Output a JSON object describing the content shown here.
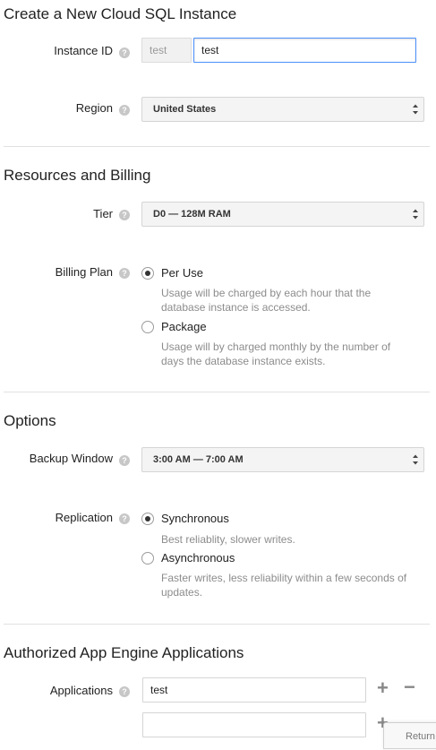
{
  "instance": {
    "title": "Create a New Cloud SQL Instance",
    "id_label": "Instance ID",
    "id_prefix": "test",
    "id_value": "test",
    "region_label": "Region",
    "region_value": "United States"
  },
  "resources": {
    "title": "Resources and Billing",
    "tier_label": "Tier",
    "tier_value": "D0 — 128M RAM",
    "billing_label": "Billing Plan",
    "plans": [
      {
        "label": "Per Use",
        "desc": "Usage will be charged by each hour that the database instance is accessed.",
        "checked": true
      },
      {
        "label": "Package",
        "desc": "Usage will by charged monthly by the number of days the database instance exists.",
        "checked": false
      }
    ]
  },
  "options": {
    "title": "Options",
    "backup_label": "Backup Window",
    "backup_value": "3:00 AM — 7:00 AM",
    "replication_label": "Replication",
    "replication": [
      {
        "label": "Synchronous",
        "desc": "Best reliablity, slower writes.",
        "checked": true
      },
      {
        "label": "Asynchronous",
        "desc": "Faster writes, less reliability within a few seconds of updates.",
        "checked": false
      }
    ]
  },
  "apps": {
    "title": "Authorized App Engine Applications",
    "label": "Applications",
    "values": [
      "test",
      ""
    ],
    "add_symbol": "+",
    "remove_symbol": "−"
  },
  "return_label": "Return",
  "help_symbol": "?",
  "colors": {
    "focus_border": "#4d90fe",
    "divider": "#e1e1e1",
    "help": "#c7c7c7"
  }
}
